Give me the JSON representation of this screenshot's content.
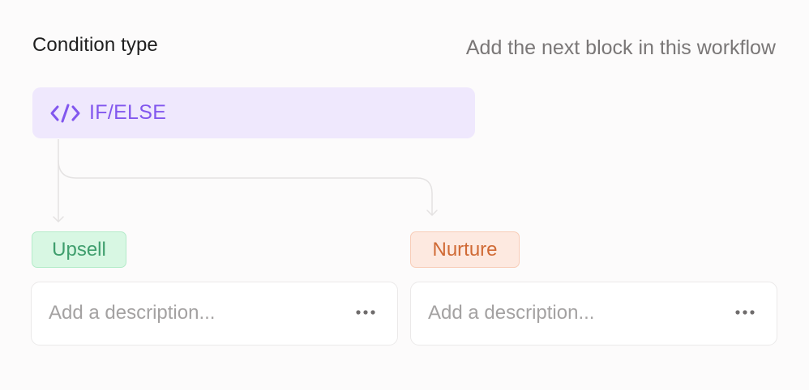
{
  "header": {
    "title": "Condition type",
    "hint": "Add the next block in this workflow"
  },
  "condition_block": {
    "label": "IF/ELSE",
    "icon": "code-icon",
    "accent": "#8257ee",
    "background": "#efe8fd"
  },
  "branches": [
    {
      "tag": "Upsell",
      "tag_color": "#3f9e6d",
      "tag_background": "#d8f7e3",
      "description_placeholder": "Add a description...",
      "menu_icon": "more-horizontal-icon"
    },
    {
      "tag": "Nurture",
      "tag_color": "#d06a35",
      "tag_background": "#fde9e0",
      "description_placeholder": "Add a description...",
      "menu_icon": "more-horizontal-icon"
    }
  ]
}
